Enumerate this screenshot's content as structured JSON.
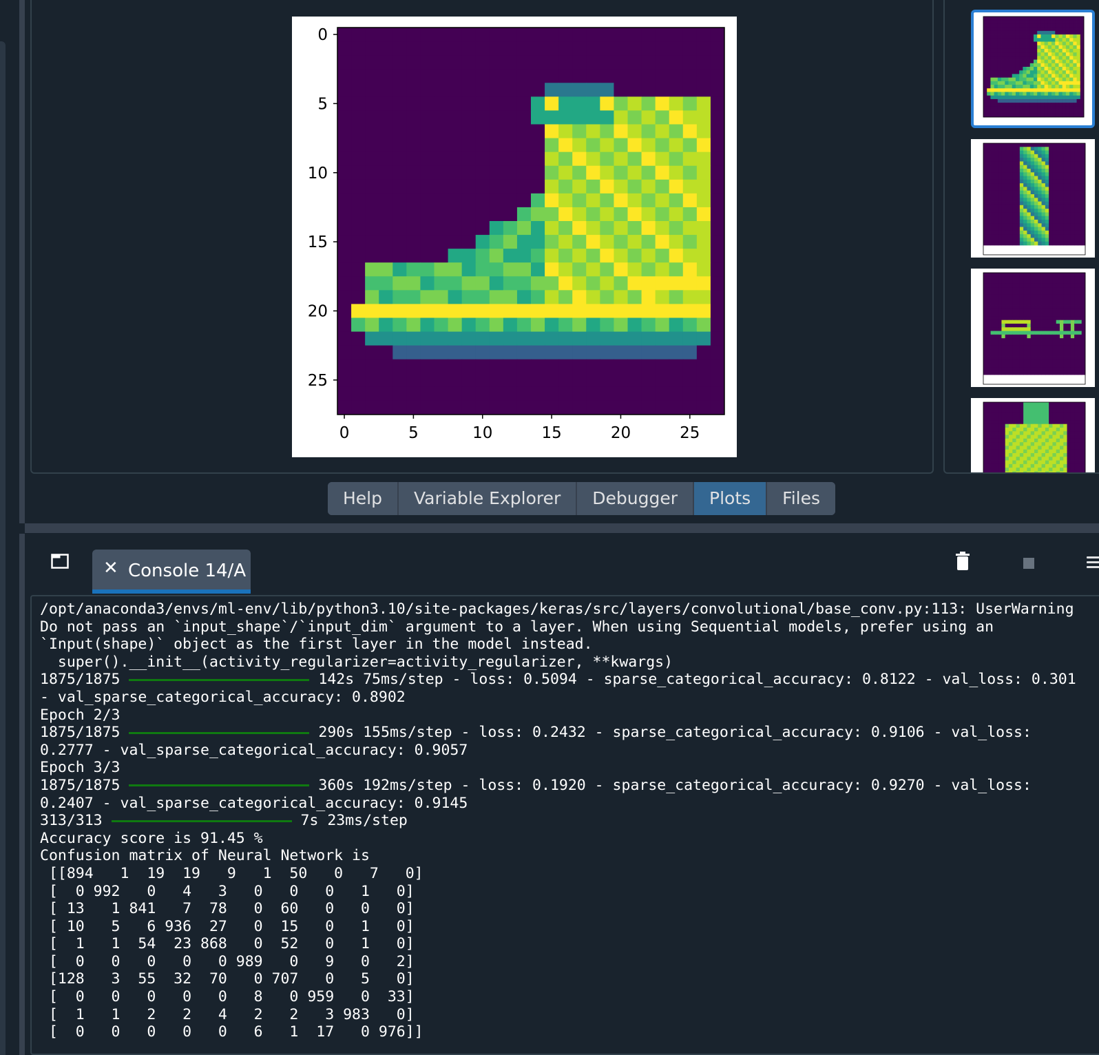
{
  "tabs": [
    "Help",
    "Variable Explorer",
    "Debugger",
    "Plots",
    "Files"
  ],
  "active_tab": "Plots",
  "console": {
    "tab_label": "Console 14/A",
    "close_glyph": "✕",
    "lines": [
      "/opt/anaconda3/envs/ml-env/lib/python3.10/site-packages/keras/src/layers/convolutional/base_conv.py:113: UserWarning",
      "Do not pass an `input_shape`/`input_dim` argument to a layer. When using Sequential models, prefer using an",
      "`Input(shape)` object as the first layer in the model instead.",
      "  super().__init__(activity_regularizer=activity_regularizer, **kwargs)",
      "1875/1875 {bar20} 142s 75ms/step - loss: 0.5094 - sparse_categorical_accuracy: 0.8122 - val_loss: 0.301",
      "- val_sparse_categorical_accuracy: 0.8902",
      "Epoch 2/3",
      "1875/1875 {bar20} 290s 155ms/step - loss: 0.2432 - sparse_categorical_accuracy: 0.9106 - val_loss:",
      "0.2777 - val_sparse_categorical_accuracy: 0.9057",
      "Epoch 3/3",
      "1875/1875 {bar20} 360s 192ms/step - loss: 0.1920 - sparse_categorical_accuracy: 0.9270 - val_loss:",
      "0.2407 - val_sparse_categorical_accuracy: 0.9145",
      "313/313 {bar20} 7s 23ms/step",
      "Accuracy score is 91.45 %",
      "Confusion matrix of Neural Network is",
      " [[894   1  19  19   9   1  50   0   7   0]",
      " [  0 992   0   4   3   0   0   0   1   0]",
      " [ 13   1 841   7  78   0  60   0   0   0]",
      " [ 10   5   6 936  27   0  15   0   1   0]",
      " [  1   1  54  23 868   0  52   0   1   0]",
      " [  0   0   0   0   0 989   0   9   0   2]",
      " [128   3  55  32  70   0 707   0   5   0]",
      " [  0   0   0   0   0   8   0 959   0  33]",
      " [  1   1   2   2   4   2   2   3 983   0]",
      " [  0   0   0   0   0   6   1  17   0 976]]"
    ]
  },
  "plot": {
    "x_ticks": [
      "0",
      "5",
      "10",
      "15",
      "20",
      "25"
    ],
    "y_ticks": [
      "0",
      "5",
      "10",
      "15",
      "20",
      "25"
    ]
  },
  "colors": {
    "accent": "#346792",
    "progress": "#0f7a10",
    "viridis_low": "#440154",
    "viridis_high": "#fde725"
  }
}
